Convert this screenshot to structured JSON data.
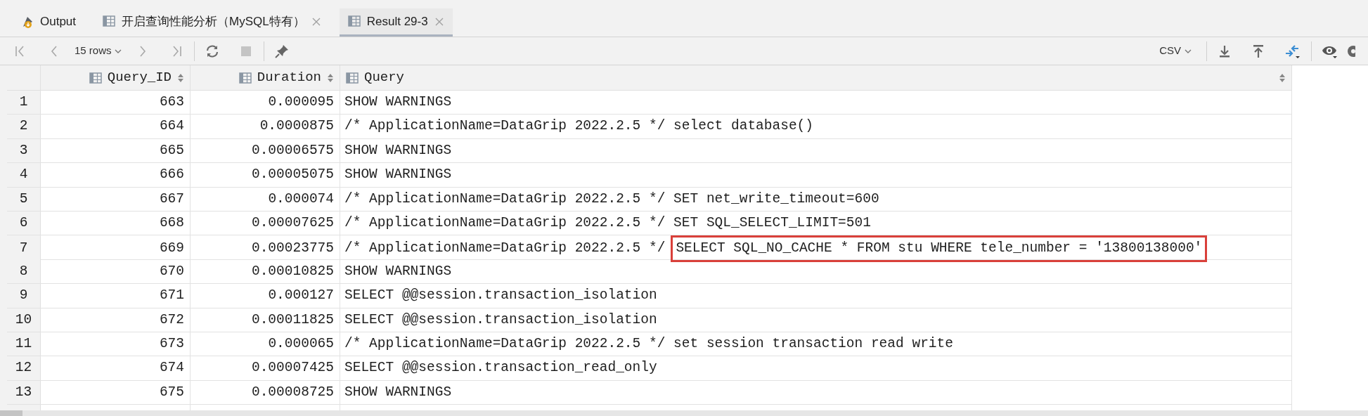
{
  "tabs": [
    {
      "kind": "output",
      "label": "Output",
      "closable": false,
      "selected": false
    },
    {
      "kind": "table",
      "label": "开启查询性能分析（MySQL特有）",
      "closable": true,
      "selected": false
    },
    {
      "kind": "table",
      "label": "Result 29-3",
      "closable": true,
      "selected": true
    }
  ],
  "toolbar": {
    "rows_label": "15 rows",
    "export_format": "CSV"
  },
  "table": {
    "columns": [
      "Query_ID",
      "Duration",
      "Query"
    ],
    "rows": [
      {
        "number": "1",
        "query_id": "663",
        "duration": "0.000095",
        "query": "SHOW WARNINGS"
      },
      {
        "number": "2",
        "query_id": "664",
        "duration": "0.0000875",
        "query": "/* ApplicationName=DataGrip 2022.2.5 */ select database()"
      },
      {
        "number": "3",
        "query_id": "665",
        "duration": "0.00006575",
        "query": "SHOW WARNINGS"
      },
      {
        "number": "4",
        "query_id": "666",
        "duration": "0.00005075",
        "query": "SHOW WARNINGS"
      },
      {
        "number": "5",
        "query_id": "667",
        "duration": "0.000074",
        "query": "/* ApplicationName=DataGrip 2022.2.5 */ SET net_write_timeout=600"
      },
      {
        "number": "6",
        "query_id": "668",
        "duration": "0.00007625",
        "query": "/* ApplicationName=DataGrip 2022.2.5 */ SET SQL_SELECT_LIMIT=501"
      },
      {
        "number": "7",
        "query_id": "669",
        "duration": "0.00023775",
        "query": "/* ApplicationName=DataGrip 2022.2.5 */",
        "query_boxed": "SELECT SQL_NO_CACHE * FROM stu WHERE tele_number = '13800138000'"
      },
      {
        "number": "8",
        "query_id": "670",
        "duration": "0.00010825",
        "query": "SHOW WARNINGS"
      },
      {
        "number": "9",
        "query_id": "671",
        "duration": "0.000127",
        "query": "SELECT @@session.transaction_isolation"
      },
      {
        "number": "10",
        "query_id": "672",
        "duration": "0.00011825",
        "query": "SELECT @@session.transaction_isolation"
      },
      {
        "number": "11",
        "query_id": "673",
        "duration": "0.000065",
        "query": "/* ApplicationName=DataGrip 2022.2.5 */ set session transaction read write"
      },
      {
        "number": "12",
        "query_id": "674",
        "duration": "0.00007425",
        "query": "SELECT @@session.transaction_read_only"
      },
      {
        "number": "13",
        "query_id": "675",
        "duration": "0.00008725",
        "query": "SHOW WARNINGS"
      }
    ]
  }
}
